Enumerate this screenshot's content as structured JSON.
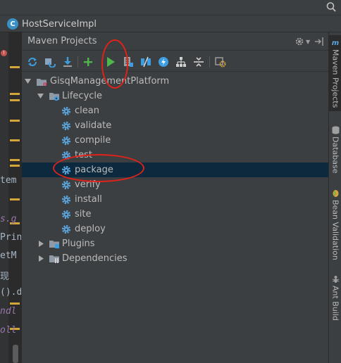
{
  "file_tab": {
    "icon_letter": "C",
    "label": "HostServiceImpl"
  },
  "editor": {
    "fragments": [
      "tem",
      "s.g",
      "Prin",
      "etM",
      "现",
      "().d",
      "ndl",
      "oll"
    ]
  },
  "maven": {
    "title": "Maven Projects",
    "toolbar": [
      "reimport-icon",
      "generate-sources-icon",
      "download-icon",
      "add-icon",
      "run-icon",
      "execute-goal-icon",
      "toggle-offline-icon",
      "skip-tests-icon",
      "show-dependencies-icon",
      "collapse-all-icon",
      "settings-icon"
    ],
    "project": "GisqManagementPlatform",
    "lifecycle_label": "Lifecycle",
    "goals": [
      "clean",
      "validate",
      "compile",
      "test",
      "package",
      "verify",
      "install",
      "site",
      "deploy"
    ],
    "selected_goal": "package",
    "plugins_label": "Plugins",
    "dependencies_label": "Dependencies"
  },
  "right_stripe": {
    "tabs": [
      "Maven Projects",
      "Database",
      "Bean Validation",
      "Ant Build"
    ]
  },
  "colors": {
    "panel_bg": "#3c3f41",
    "selection": "#0d293e",
    "run_green": "#4fb64c",
    "annotation_red": "#e0221a",
    "goal_gear": "#5aa6dc"
  }
}
